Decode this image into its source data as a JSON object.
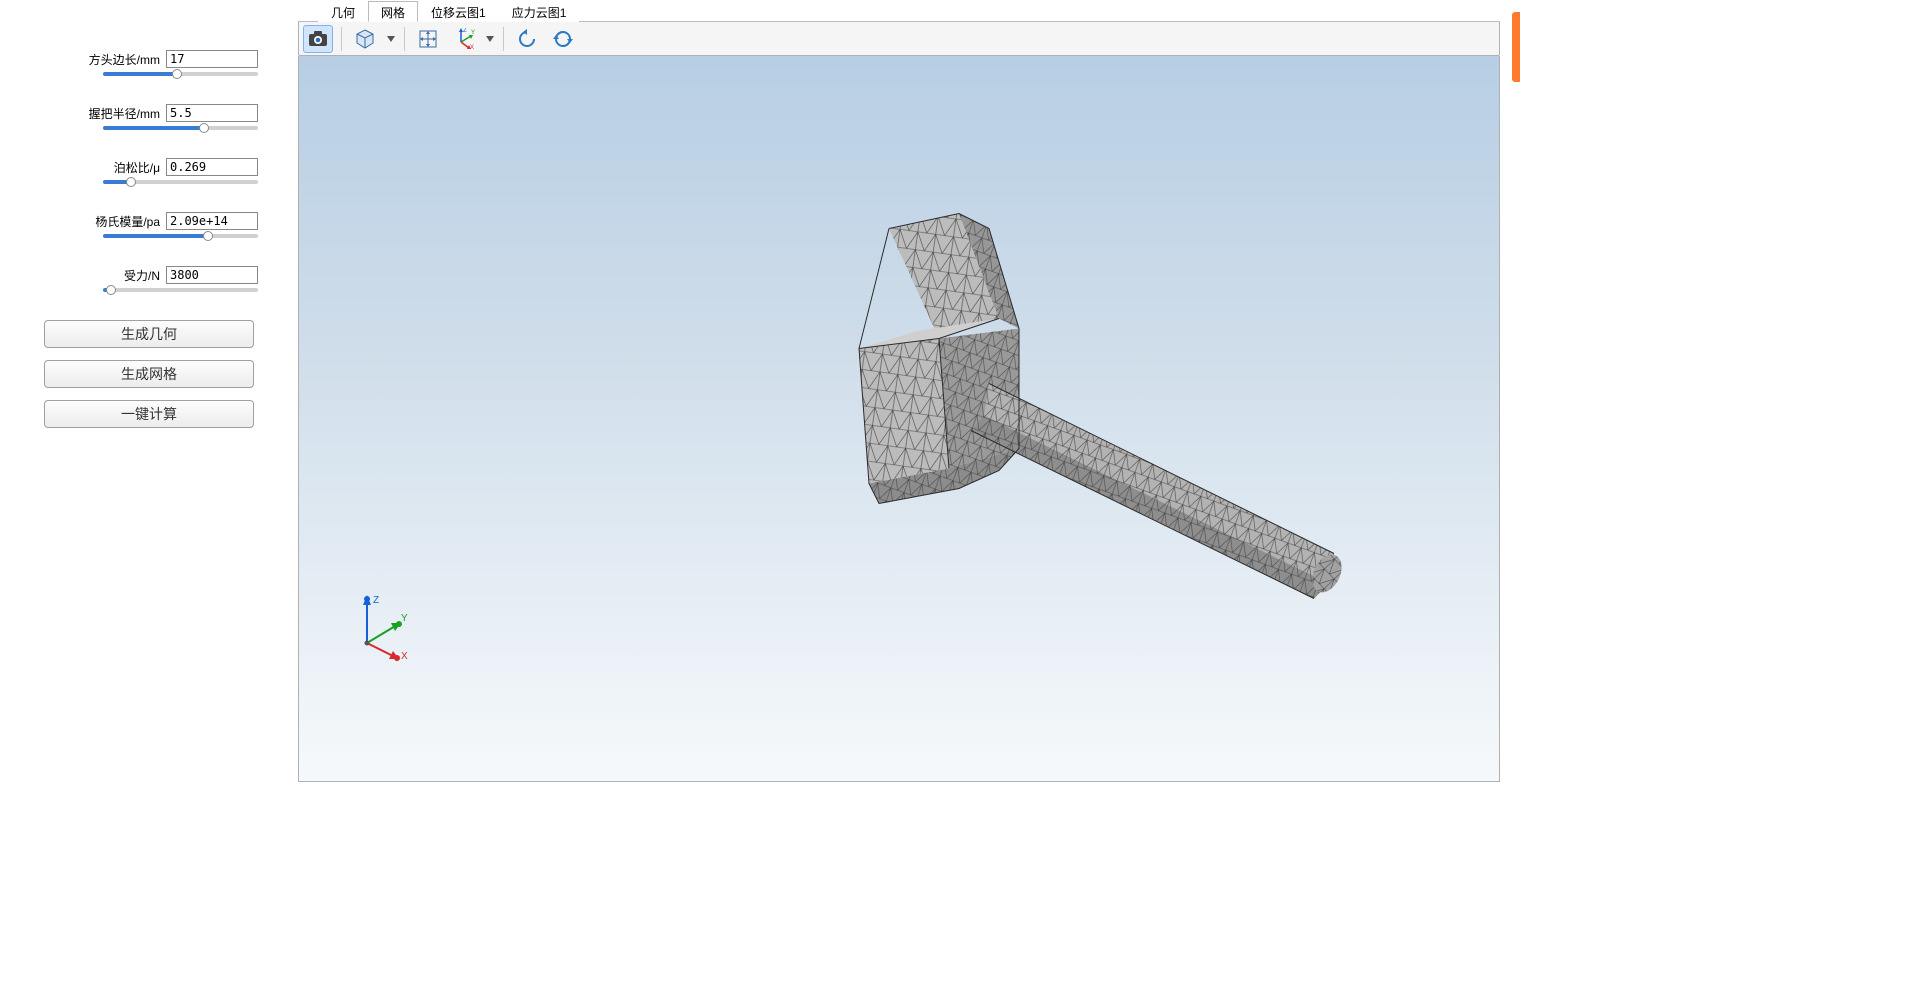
{
  "tabs": [
    {
      "label": "几何",
      "active": false
    },
    {
      "label": "网格",
      "active": true
    },
    {
      "label": "位移云图1",
      "active": false
    },
    {
      "label": "应力云图1",
      "active": false
    }
  ],
  "params": {
    "head_edge": {
      "label": "方头边长/mm",
      "value": "17",
      "pct": 48
    },
    "grip_radius": {
      "label": "握把半径/mm",
      "value": "5.5",
      "pct": 65
    },
    "poisson": {
      "label": "泊松比/μ",
      "value": "0.269",
      "pct": 18
    },
    "young": {
      "label": "杨氏模量/pa",
      "value": "2.09e+14",
      "pct": 68
    },
    "force": {
      "label": "受力/N",
      "value": "3800",
      "pct": 5
    }
  },
  "buttons": {
    "gen_geometry": "生成几何",
    "gen_mesh": "生成网格",
    "compute": "一键计算"
  },
  "toolbar_icons": {
    "camera": "camera-icon",
    "cube": "cube-icon",
    "pan": "pan-icon",
    "axes": "axes-xyz-icon",
    "rotate_left": "rotate-left-icon",
    "rotate_reset": "rotate-reset-icon"
  },
  "axis_labels": {
    "x": "X",
    "y": "Y",
    "z": "Z"
  }
}
